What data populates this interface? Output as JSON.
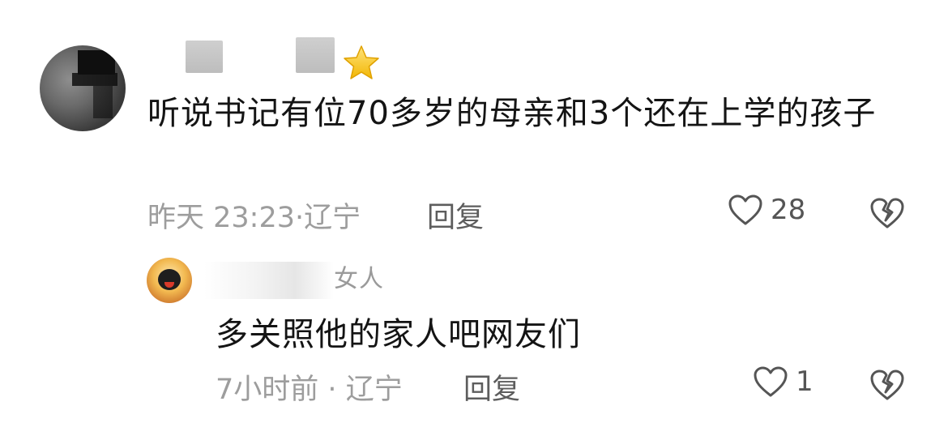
{
  "comment": {
    "text": "听说书记有位70多岁的母亲和3个还在上学的孩子",
    "time": "昨天 23:23",
    "location": "辽宁",
    "reply_label": "回复",
    "like_count": "28",
    "badge_icon": "star-icon"
  },
  "reply": {
    "username": "女人",
    "text": "多关照他的家人吧网友们",
    "time": "7小时前",
    "location": "辽宁",
    "reply_label": "回复",
    "like_count": "1"
  },
  "separator": "·",
  "colors": {
    "text": "#141414",
    "meta": "#9d9d9d",
    "action": "#5d5d5d",
    "star": "#f5c21b"
  }
}
